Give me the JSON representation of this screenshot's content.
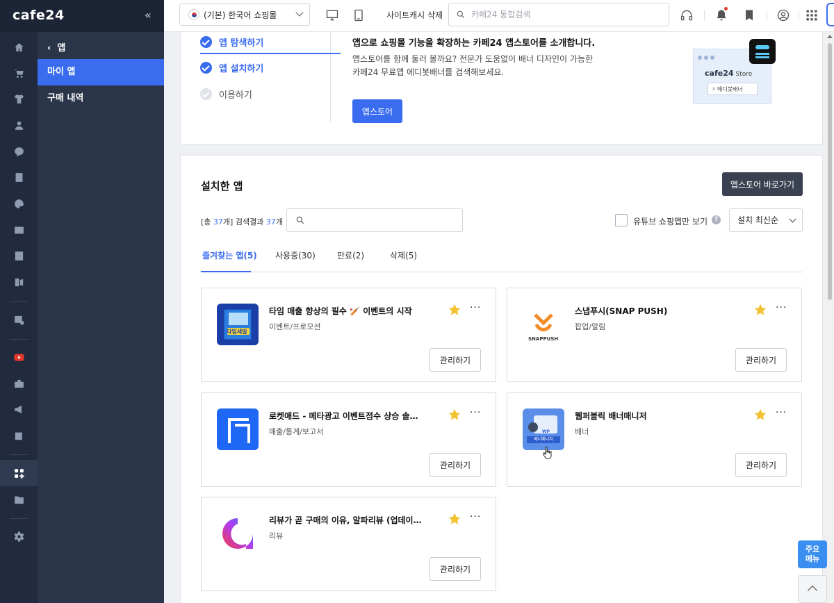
{
  "brand": {
    "logo": "cafe24"
  },
  "sidebar": {
    "back_label": "앱",
    "items": [
      {
        "label": "마이 앱",
        "active": true
      },
      {
        "label": "구매 내역",
        "active": false
      }
    ]
  },
  "topbar": {
    "shop_select": "(기본) 한국어 쇼핑몰",
    "cache_label": "사이트캐시 삭제",
    "search_placeholder": "카페24 통합검색"
  },
  "intro": {
    "steps": [
      {
        "label": "앱 탐색하기",
        "done": true
      },
      {
        "label": "앱 설치하기",
        "done": true
      },
      {
        "label": "이용하기",
        "done": false
      }
    ],
    "title": "앱으로 쇼핑몰 기능을 확장하는 카페24 앱스토어를 소개합니다.",
    "desc_line1": "앱스토어를 함께 둘러 볼까요? 전문가 도움없이 배너 디자인이 가능한",
    "desc_line2": "카페24 무료앱 에디봇배너를 검색해보세요.",
    "button": "앱스토어",
    "illu_brand": "cafe24",
    "illu_store": "Store",
    "illu_search": "에디봇배너"
  },
  "installed": {
    "title": "설치한 앱",
    "goto_store": "앱스토어 바로가기",
    "count_prefix": "[총 ",
    "total": "37",
    "count_mid": "개] 검색결과 ",
    "result": "37",
    "count_suffix": "개",
    "youtube_only": "유튜브 쇼핑앱만 보기",
    "sort": "설치 최신순",
    "tabs": [
      {
        "label": "즐겨찾는 앱(5)",
        "active": true
      },
      {
        "label": "사용중(30)",
        "active": false
      },
      {
        "label": "만료(2)",
        "active": false
      },
      {
        "label": "삭제(5)",
        "active": false
      }
    ],
    "apps": [
      {
        "name": "타임 매출 향상의 필수 🏏 이벤트의 시작",
        "category": "이벤트/프로모션",
        "manage": "관리하기",
        "thumb_text": "타임세일"
      },
      {
        "name": "스냅푸시(SNAP PUSH)",
        "category": "팝업/알림",
        "manage": "관리하기",
        "thumb_text": "SNAPPUSH"
      },
      {
        "name": "로켓애드 - 메타광고 이벤트점수 상승 솔루션",
        "category": "매출/통계/보고서",
        "manage": "관리하기"
      },
      {
        "name": "웹퍼블릭 배너매니저",
        "category": "배너",
        "manage": "관리하기",
        "thumb_text": "배너매니저",
        "thumb_tag": "WP"
      },
      {
        "name": "리뷰가 곧 구매의 이유, 알파리뷰 (업데이트)",
        "category": "리뷰",
        "manage": "관리하기"
      }
    ]
  },
  "floating": {
    "menu_line1": "주요",
    "menu_line2": "메뉴"
  },
  "colors": {
    "accent": "#3a6cf0",
    "rail": "#212b3d",
    "star": "#f2c230"
  }
}
